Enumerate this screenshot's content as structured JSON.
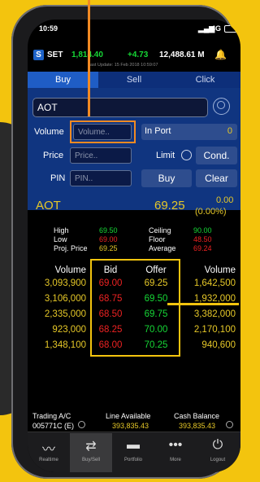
{
  "status": {
    "time": "10:59",
    "network": "4G"
  },
  "ticker": {
    "label": "SET",
    "value1": "1,814.40",
    "change": "+4.73",
    "value2": "12,488.61 M",
    "update": "Last Update: 15 Feb 2018 10:59:07"
  },
  "tabs": [
    "Buy",
    "Sell",
    "Click"
  ],
  "symbol": "AOT",
  "form": {
    "volume_label": "Volume",
    "volume_placeholder": "Volume..",
    "inport_label": "In Port",
    "inport_value": "0",
    "price_label": "Price",
    "price_placeholder": "Price..",
    "limit_label": "Limit",
    "cond_label": "Cond.",
    "pin_label": "PIN",
    "pin_placeholder": "PIN..",
    "buy_label": "Buy",
    "clear_label": "Clear"
  },
  "quote": {
    "name": "AOT",
    "price": "69.25",
    "change": "0.00",
    "change_pct": "(0.00%)",
    "high_label": "High",
    "high": "69.50",
    "low_label": "Low",
    "low": "69.00",
    "proj_label": "Proj. Price",
    "proj": "69.25",
    "ceiling_label": "Ceiling",
    "ceiling": "90.00",
    "floor_label": "Floor",
    "floor": "48.50",
    "average_label": "Average",
    "average": "69.24"
  },
  "book": {
    "headers": [
      "Volume",
      "Bid",
      "Offer",
      "Volume"
    ],
    "rows": [
      [
        "3,093,900",
        "69.00",
        "69.25",
        "1,642,500"
      ],
      [
        "3,106,000",
        "68.75",
        "69.50",
        "1,932,000"
      ],
      [
        "2,335,000",
        "68.50",
        "69.75",
        "3,382,000"
      ],
      [
        "923,000",
        "68.25",
        "70.00",
        "2,170,100"
      ],
      [
        "1,348,100",
        "68.00",
        "70.25",
        "940,600"
      ]
    ]
  },
  "account": {
    "trading_label": "Trading A/C",
    "trading_value": "005771C (E)",
    "line_label": "Line Available",
    "line_value": "393,835.43",
    "cash_label": "Cash Balance",
    "cash_value": "393,835.43"
  },
  "nav": [
    "Realtime",
    "Buy/Sell",
    "Portfolio",
    "More",
    "Logout"
  ],
  "colors": {
    "accent": "#f28a23",
    "highlight": "#f3c40e",
    "up": "#16d836",
    "down": "#ee2222"
  }
}
